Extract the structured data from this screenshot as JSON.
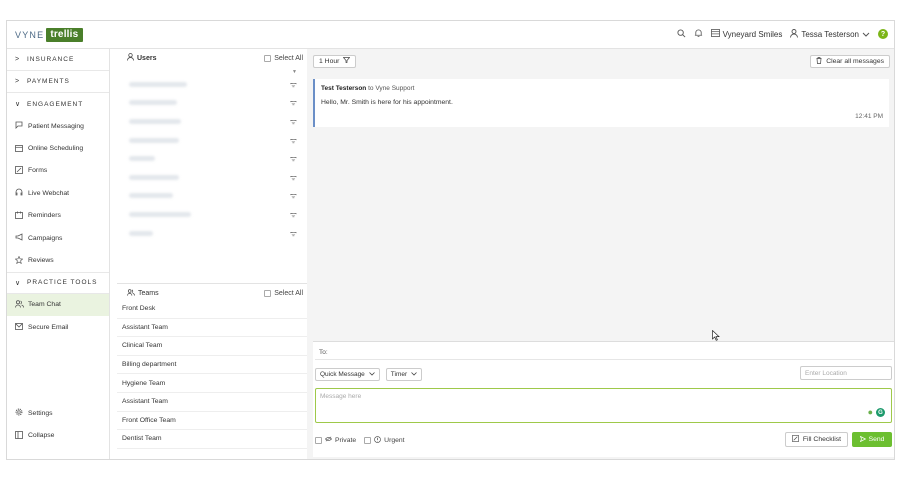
{
  "header": {
    "logo_left": "VYNE",
    "logo_right": "trellis",
    "practice": "Vyneyard Smiles",
    "user": "Tessa Testerson",
    "help": "?"
  },
  "sidebar": {
    "sections": [
      {
        "label": "INSURANCE",
        "chev": ">"
      },
      {
        "label": "PAYMENTS",
        "chev": ">"
      }
    ],
    "engagement": {
      "label": "ENGAGEMENT",
      "chev": "∨"
    },
    "engagement_items": [
      {
        "label": "Patient Messaging",
        "icon": "chat-icon"
      },
      {
        "label": "Online Scheduling",
        "icon": "calendar-icon"
      },
      {
        "label": "Forms",
        "icon": "form-icon"
      },
      {
        "label": "Live Webchat",
        "icon": "webchat-icon"
      },
      {
        "label": "Reminders",
        "icon": "reminder-icon"
      },
      {
        "label": "Campaigns",
        "icon": "megaphone-icon"
      },
      {
        "label": "Reviews",
        "icon": "star-icon"
      }
    ],
    "practice_tools": {
      "label": "PRACTICE TOOLS",
      "chev": "∨"
    },
    "tools_items": [
      {
        "label": "Team Chat",
        "icon": "team-icon",
        "active": true
      },
      {
        "label": "Secure Email",
        "icon": "mail-icon"
      }
    ],
    "settings": "Settings",
    "collapse": "Collapse"
  },
  "users_panel": {
    "title": "Users",
    "select_all": "Select All"
  },
  "teams_panel": {
    "title": "Teams",
    "select_all": "Select All",
    "teams": [
      "Front Desk",
      "Assistant Team",
      "Clinical Team",
      "Billing department",
      "Hygiene Team",
      "Assistant Team",
      "Front Office Team",
      "Dentist Team"
    ]
  },
  "main": {
    "filter": "1 Hour",
    "clear": "Clear all messages",
    "message": {
      "sender": "Test Testerson",
      "to_word": "to",
      "recipient": "Vyne Support",
      "text": "Hello, Mr. Smith is here for his appointment.",
      "time": "12:41 PM"
    }
  },
  "compose": {
    "to_label": "To:",
    "quick_message": "Quick Message",
    "timer": "Timer",
    "location_placeholder": "Enter Location",
    "message_placeholder": "Message here",
    "private": "Private",
    "urgent": "Urgent",
    "fill_checklist": "Fill Checklist",
    "send": "Send"
  },
  "colors": {
    "brand_green": "#4a7f2a",
    "send_green": "#6cbf30",
    "active_bg": "#eaf3e0",
    "message_accent": "#6b8fc7"
  }
}
